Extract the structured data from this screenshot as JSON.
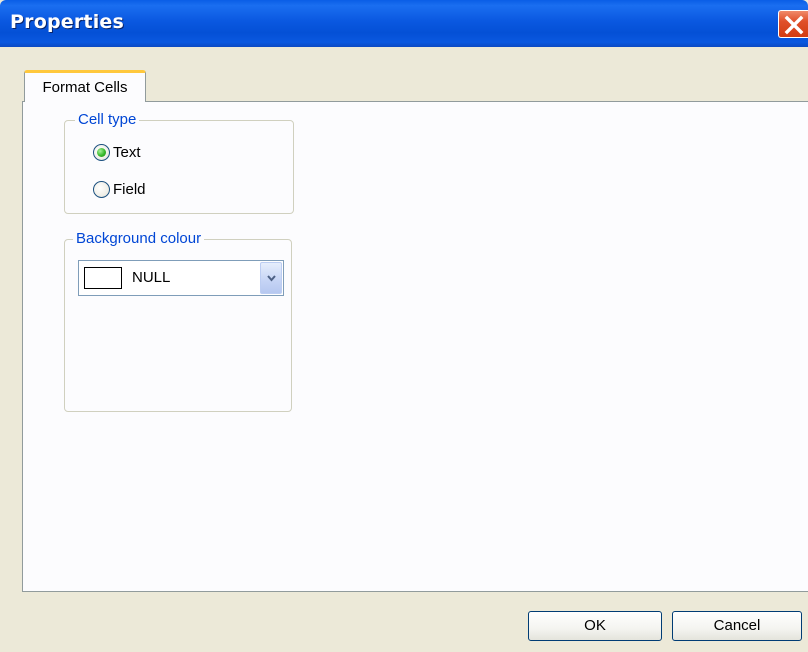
{
  "window": {
    "title": "Properties",
    "close_icon": "close-icon"
  },
  "tabs": [
    {
      "label": "Format Cells",
      "selected": true
    }
  ],
  "cell_type": {
    "legend": "Cell type",
    "options": [
      {
        "label": "Text",
        "checked": true
      },
      {
        "label": "Field",
        "checked": false
      }
    ]
  },
  "background": {
    "legend": "Background colour",
    "selected_value": "NULL",
    "swatch_color": "#ffffff",
    "dropdown_icon": "chevron-down-icon"
  },
  "buttons": {
    "ok": "OK",
    "cancel": "Cancel"
  },
  "colors": {
    "titlebar": "#0a58e0",
    "close": "#e0502a",
    "tab_accent": "#ffc83c",
    "legend_text": "#0046d5",
    "radio_checked": "#37b82a"
  }
}
